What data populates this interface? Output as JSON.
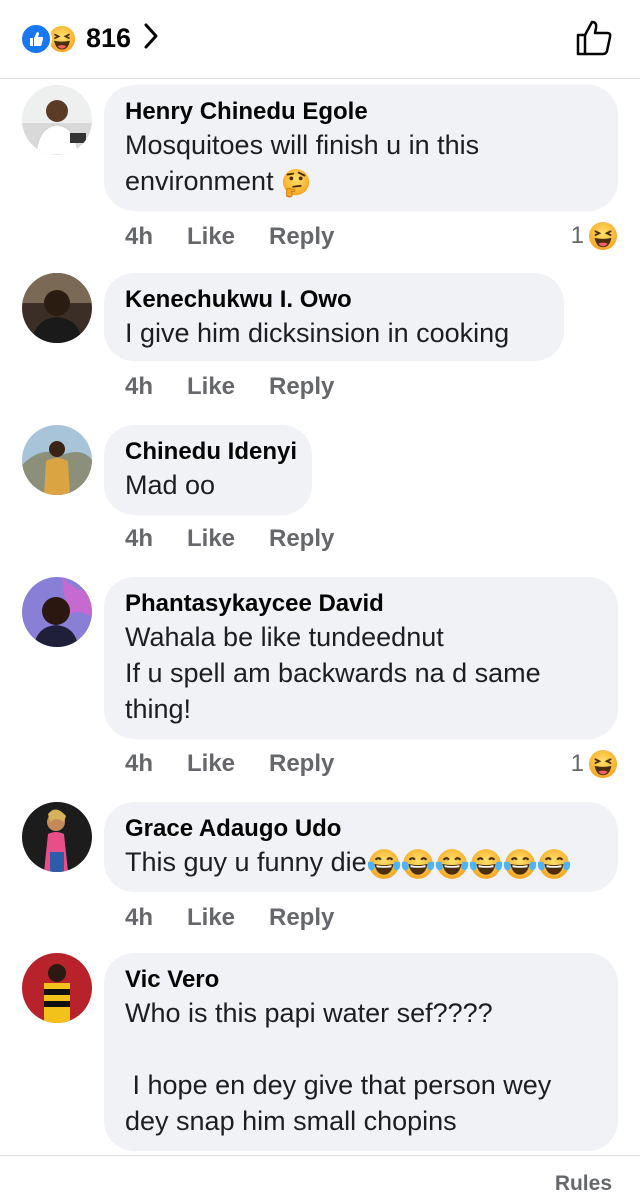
{
  "header": {
    "reaction_count": "816",
    "icons": [
      "like-badge-icon",
      "haha-badge-icon",
      "chevron-right-icon",
      "thumbs-up-outline-icon"
    ]
  },
  "comments": [
    {
      "author": "Henry Chinedu Egole",
      "text": "Mosquitoes will finish u in this environment",
      "emoji": "thinking-face",
      "time": "4h",
      "like": "Like",
      "reply": "Reply",
      "reactions": "1",
      "reaction_icon": "haha"
    },
    {
      "author": "Kenechukwu I. Owo",
      "text": "I give him dicksinsion in cooking",
      "time": "4h",
      "like": "Like",
      "reply": "Reply"
    },
    {
      "author": "Chinedu Idenyi",
      "text": "Mad oo",
      "time": "4h",
      "like": "Like",
      "reply": "Reply"
    },
    {
      "author": "Phantasykaycee David",
      "text": "Wahala be like tundeednut\nIf u spell am backwards na d same thing!",
      "time": "4h",
      "like": "Like",
      "reply": "Reply",
      "reactions": "1",
      "reaction_icon": "haha"
    },
    {
      "author": "Grace Adaugo Udo",
      "text": "This guy u funny die",
      "emoji": "face-with-tears-of-joy x6",
      "time": "4h",
      "like": "Like",
      "reply": "Reply"
    },
    {
      "author": "Vic Vero",
      "text": "Who is this papi water sef????\n\n I hope en dey give that person wey dey snap him small chopins"
    }
  ],
  "footer": {
    "rules": "Rules"
  },
  "colors": {
    "like_blue": "#1877f2",
    "bubble": "#f0f2f5",
    "meta_gray": "#65676b",
    "haha_yellow": "#f7c331"
  }
}
